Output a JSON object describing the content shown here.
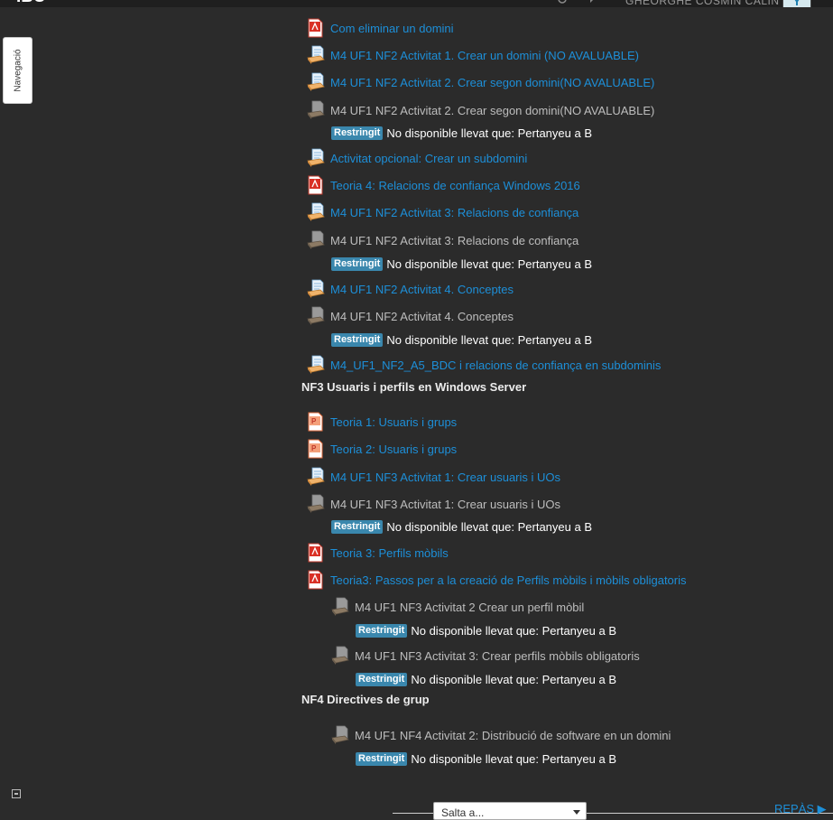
{
  "header": {
    "brand": "IBU",
    "user_name": "GHEORGHE COSMIN CALIN",
    "colors": {
      "bar": "#1f1f1f",
      "link": "#1d8fd8",
      "badge": "#3a87ad"
    }
  },
  "sidebar": {
    "nav_tab_label": "Navegació"
  },
  "items": [
    {
      "text": "Com eliminar un domini",
      "icon": "pdf-icon",
      "link": true
    },
    {
      "text": "M4 UF1 NF2 Activitat 1. Crear un domini (NO AVALUABLE)",
      "icon": "assignment-icon",
      "link": true
    },
    {
      "text": "M4 UF1 NF2 Activitat 2. Crear segon domini(NO AVALUABLE)",
      "icon": "assignment-icon",
      "link": true
    },
    {
      "text": "M4 UF1 NF2 Activitat 2. Crear segon domini(NO AVALUABLE)",
      "icon": "assignment-disabled-icon",
      "link": false
    },
    {
      "text": "Activitat opcional: Crear un subdomini",
      "icon": "assignment-icon",
      "link": true
    },
    {
      "text": "Teoria 4: Relacions de confiança Windows 2016",
      "icon": "pdf-icon",
      "link": true
    },
    {
      "text": "M4 UF1 NF2 Activitat 3: Relacions de confiança",
      "icon": "assignment-icon",
      "link": true
    },
    {
      "text": "M4 UF1 NF2 Activitat 3: Relacions de confiança",
      "icon": "assignment-disabled-icon",
      "link": false
    },
    {
      "text": "M4 UF1 NF2 Activitat 4. Conceptes",
      "icon": "assignment-icon",
      "link": true
    },
    {
      "text": "M4 UF1 NF2 Activitat 4. Conceptes",
      "icon": "assignment-disabled-icon",
      "link": false
    },
    {
      "text": "M4_UF1_NF2_A5_BDC i relacions de confiança en subdominis",
      "icon": "assignment-icon",
      "link": true
    },
    {
      "text": "Teoria 1: Usuaris i grups",
      "icon": "powerpoint-icon",
      "link": true
    },
    {
      "text": "Teoria 2: Usuaris i grups",
      "icon": "powerpoint-icon",
      "link": true
    },
    {
      "text": "M4 UF1 NF3 Activitat 1: Crear usuaris i UOs",
      "icon": "assignment-icon",
      "link": true
    },
    {
      "text": "M4 UF1 NF3 Activitat 1: Crear usuaris i UOs",
      "icon": "assignment-disabled-icon",
      "link": false
    },
    {
      "text": "Teoria 3: Perfils mòbils",
      "icon": "pdf-icon",
      "link": true
    },
    {
      "text": "Teoria3: Passos per a la creació de Perfils mòbils i mòbils obligatoris",
      "icon": "pdf-icon",
      "link": true
    },
    {
      "text": "M4 UF1 NF3 Activitat 2 Crear un perfil mòbil",
      "icon": "assignment-disabled-icon",
      "link": false
    },
    {
      "text": "M4 UF1 NF3 Activitat 3: Crear perfils mòbils obligatoris",
      "icon": "assignment-disabled-icon",
      "link": false
    },
    {
      "text": "M4 UF1 NF4 Activitat 2: Distribució de software en un domini",
      "icon": "assignment-disabled-icon",
      "link": false
    }
  ],
  "restriction": {
    "badge": "Restringit",
    "text": "No disponible llevat que: Pertanyeu a B"
  },
  "sections": {
    "nf3": "NF3 Usuaris i perfils en Windows Server",
    "nf4": "NF4 Directives de grup"
  },
  "footer": {
    "jump_select": "Salta a...",
    "next_link": "REPÀS ▶"
  }
}
